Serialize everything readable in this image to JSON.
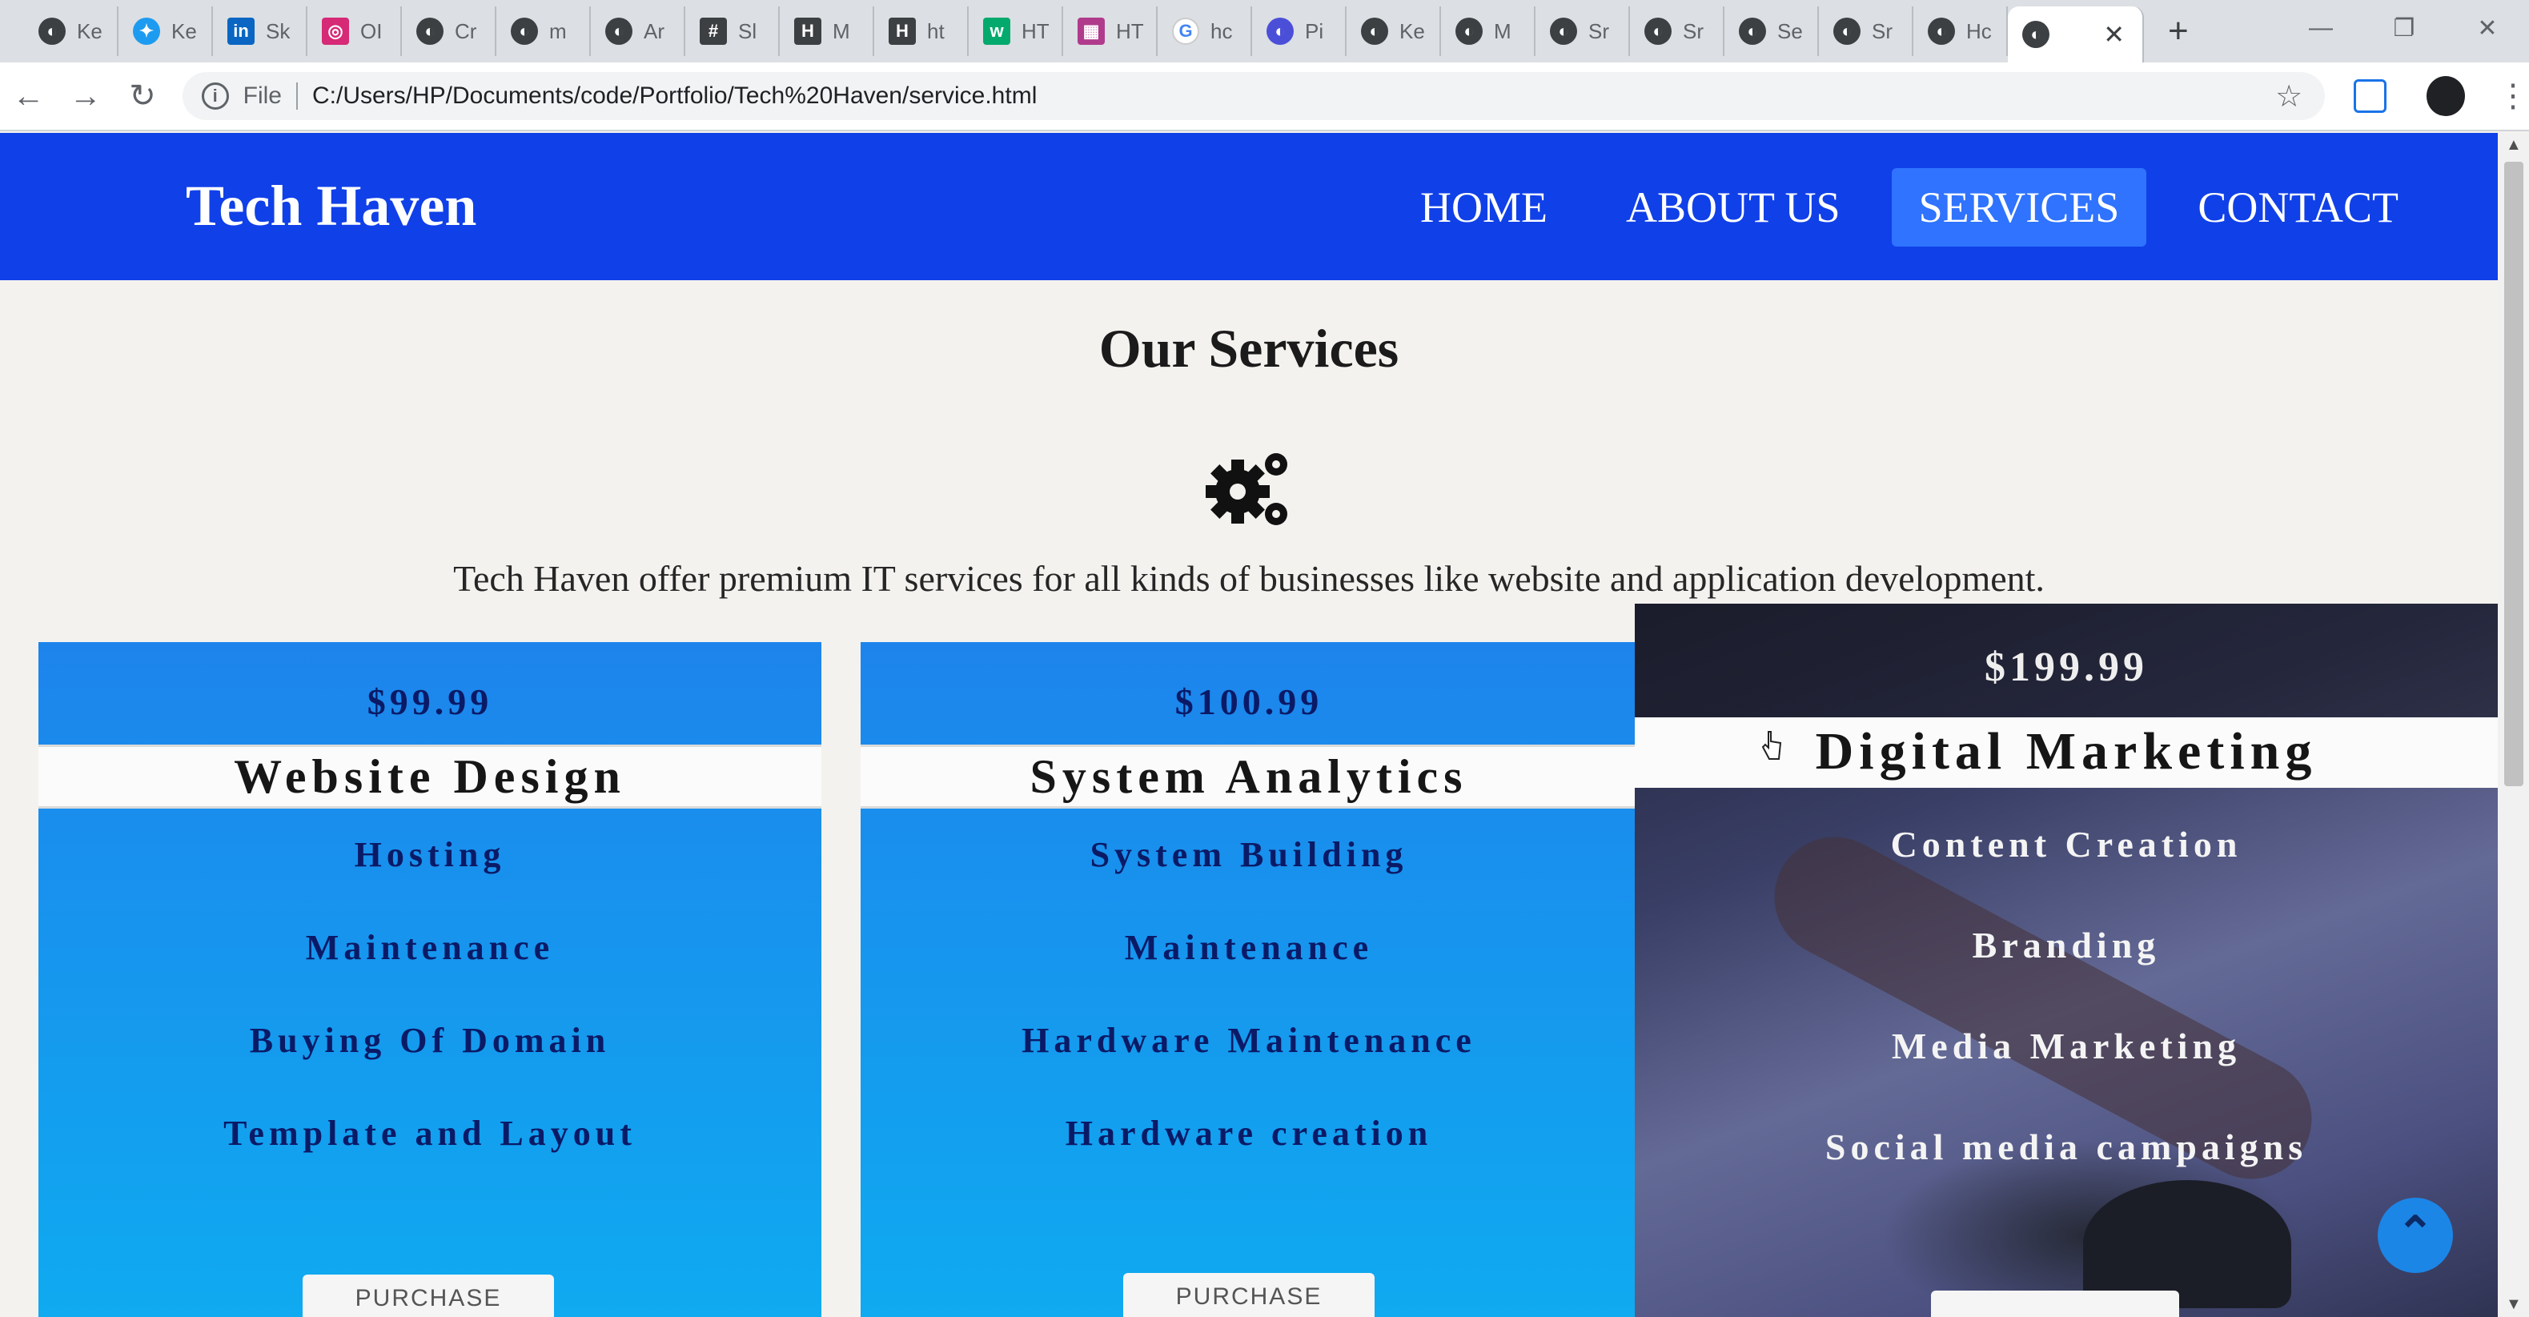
{
  "browser": {
    "tabs": [
      {
        "label": "Ke",
        "icon": "globe-icon"
      },
      {
        "label": "Ke",
        "icon": "twitter-icon"
      },
      {
        "label": "Sk",
        "icon": "linkedin-icon"
      },
      {
        "label": "OI",
        "icon": "instagram-icon"
      },
      {
        "label": "Cr",
        "icon": "globe-icon"
      },
      {
        "label": "m",
        "icon": "globe-icon"
      },
      {
        "label": "Ar",
        "icon": "globe-icon"
      },
      {
        "label": "Sl",
        "icon": "slack-icon"
      },
      {
        "label": "M",
        "icon": "hashnode-icon"
      },
      {
        "label": "ht",
        "icon": "hashnode-icon"
      },
      {
        "label": "HT",
        "icon": "w3schools-icon"
      },
      {
        "label": "HT",
        "icon": "grid-icon"
      },
      {
        "label": "hc",
        "icon": "google-icon"
      },
      {
        "label": "Pi",
        "icon": "globe-icon"
      },
      {
        "label": "Ke",
        "icon": "globe-icon"
      },
      {
        "label": "M",
        "icon": "globe-icon"
      },
      {
        "label": "Sr",
        "icon": "globe-icon"
      },
      {
        "label": "Sr",
        "icon": "globe-icon"
      },
      {
        "label": "Se",
        "icon": "globe-icon"
      },
      {
        "label": "Sr",
        "icon": "globe-icon"
      },
      {
        "label": "Hc",
        "icon": "globe-icon"
      }
    ],
    "active_tab": {
      "label": "",
      "icon": "globe-icon"
    },
    "address": {
      "scheme": "File",
      "url": "C:/Users/HP/Documents/code/Portfolio/Tech%20Haven/service.html"
    }
  },
  "nav": {
    "brand": "Tech Haven",
    "links": [
      "HOME",
      "ABOUT US",
      "SERVICES",
      "CONTACT"
    ],
    "active": "SERVICES"
  },
  "section": {
    "title": "Our Services",
    "intro": "Tech Haven offer premium IT services for all kinds of businesses like website and application development."
  },
  "cards": [
    {
      "price": "$99.99",
      "title": "Website Design",
      "items": [
        "Hosting",
        "Maintenance",
        "Buying Of Domain",
        "Template and Layout"
      ],
      "button": "PURCHASE"
    },
    {
      "price": "$100.99",
      "title": "System Analytics",
      "items": [
        "System Building",
        "Maintenance",
        "Hardware Maintenance",
        "Hardware creation"
      ],
      "button": "PURCHASE"
    },
    {
      "price": "$199.99",
      "title": "Digital Marketing",
      "items": [
        "Content Creation",
        "Branding",
        "Media Marketing",
        "Social media campaigns"
      ],
      "button": ""
    }
  ],
  "colors": {
    "navbar": "#1040e8",
    "card_blue": "#0faaf0",
    "accent": "#2f73ff"
  }
}
